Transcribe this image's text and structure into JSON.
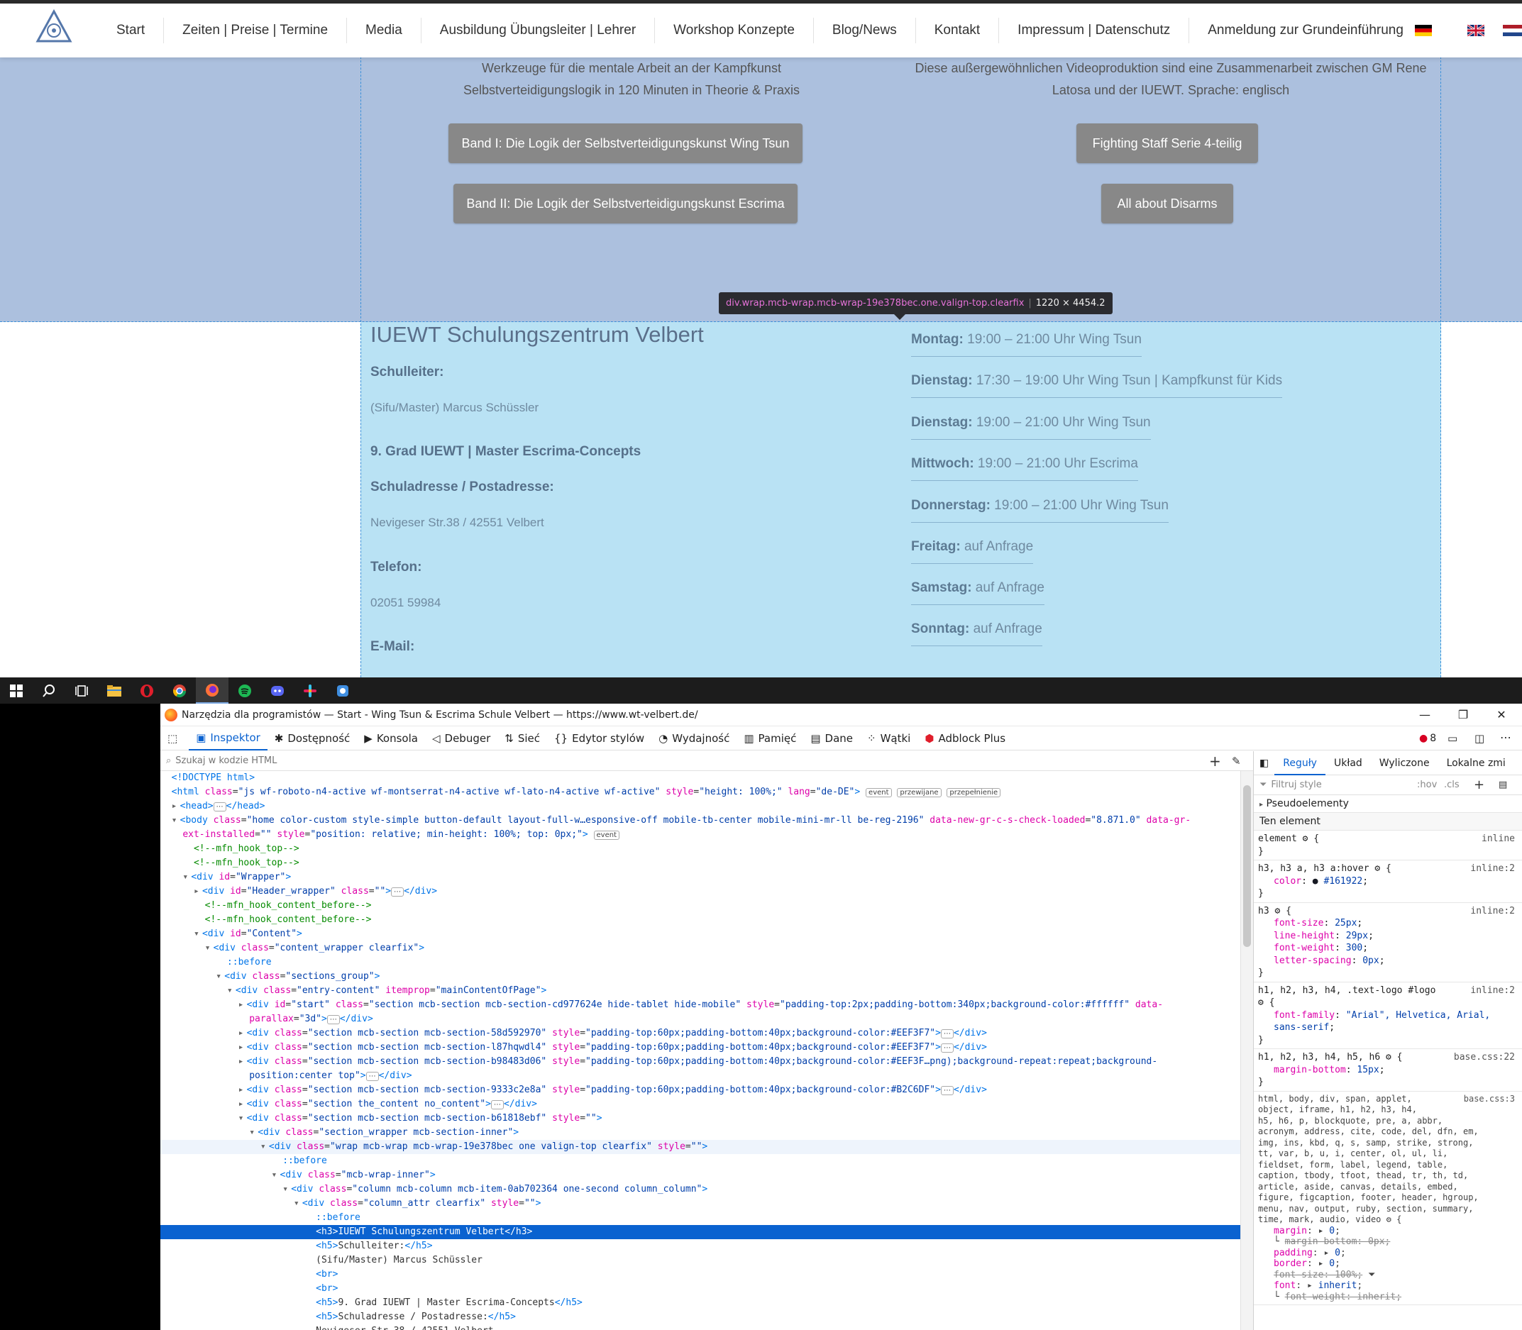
{
  "site": {
    "nav": [
      "Start",
      "Zeiten | Preise | Termine",
      "Media",
      "Ausbildung Übungsleiter | Lehrer",
      "Workshop Konzepte",
      "Blog/News",
      "Kontakt",
      "Impressum | Datenschutz",
      "Anmeldung zur Grundeinführung"
    ],
    "left_intro": [
      "Werkzeuge für die mentale Arbeit an der Kampfkunst",
      "Selbstverteidigungslogik in 120 Minuten in Theorie & Praxis"
    ],
    "right_intro": [
      "Diese außergewöhnlichen Videoproduktion sind eine Zusammenarbeit zwischen GM Rene",
      "Latosa und der IUEWT. Sprache: englisch"
    ],
    "buttons": {
      "band1": "Band I: Die Logik der Selbstverteidigungskunst Wing Tsun",
      "band2": "Band II: Die Logik der Selbstverteidigungskunst Escrima",
      "staff": "Fighting Staff Serie 4-teilig",
      "disarms": "All about Disarms"
    },
    "tooltip": {
      "selector": "div.wrap.mcb-wrap.mcb-wrap-19e378bec.one.valign-top.clearfix",
      "size": "1220 × 4454.2"
    },
    "school": {
      "title": "IUEWT Schulungszentrum Velbert",
      "leader_label": "Schulleiter:",
      "leader": "(Sifu/Master) Marcus Schüssler",
      "grade": "9. Grad IUEWT | Master Escrima-Concepts",
      "address_label": "Schuladresse / Postadresse:",
      "address": "Nevigeser Str.38 / 42551 Velbert",
      "phone_label": "Telefon:",
      "phone": "02051 59984",
      "email_label": "E-Mail:"
    },
    "schedule": [
      {
        "day": "Montag:",
        "text": " 19:00 – 21:00 Uhr Wing Tsun"
      },
      {
        "day": "Dienstag:",
        "text": " 17:30 – 19:00 Uhr Wing Tsun | Kampfkunst für Kids"
      },
      {
        "day": "Dienstag:",
        "text": " 19:00 – 21:00 Uhr Wing Tsun"
      },
      {
        "day": "Mittwoch:",
        "text": " 19:00 – 21:00 Uhr Escrima"
      },
      {
        "day": "Donnerstag:",
        "text": " 19:00 – 21:00 Uhr Wing Tsun"
      },
      {
        "day": "Freitag:",
        "text": " auf Anfrage"
      },
      {
        "day": "Samstag:",
        "text": " auf Anfrage"
      },
      {
        "day": "Sonntag:",
        "text": " auf Anfrage"
      }
    ]
  },
  "devtools": {
    "window_title": "Narzędzia dla programistów — Start - Wing Tsun & Escrima Schule Velbert — https://www.wt-velbert.de/",
    "tabs": [
      "Inspektor",
      "Dostępność",
      "Konsola",
      "Debuger",
      "Sieć",
      "Edytor stylów",
      "Wydajność",
      "Pamięć",
      "Dane",
      "Wątki",
      "Adblock Plus"
    ],
    "search_placeholder": "Szukaj w kodzie HTML",
    "error_count": "8",
    "rules_tabs": [
      "Reguły",
      "Układ",
      "Wyliczone",
      "Lokalne zmi"
    ],
    "filter_placeholder": "Filtruj style",
    "hov": ":hov",
    "cls": ".cls",
    "pseudo": "Pseudoelementy",
    "this_element": "Ten element",
    "colors": {
      "accent": "#0a62d0",
      "upper_bg": "#b2c6df",
      "highlight_lower": "#b8e0f2"
    }
  }
}
